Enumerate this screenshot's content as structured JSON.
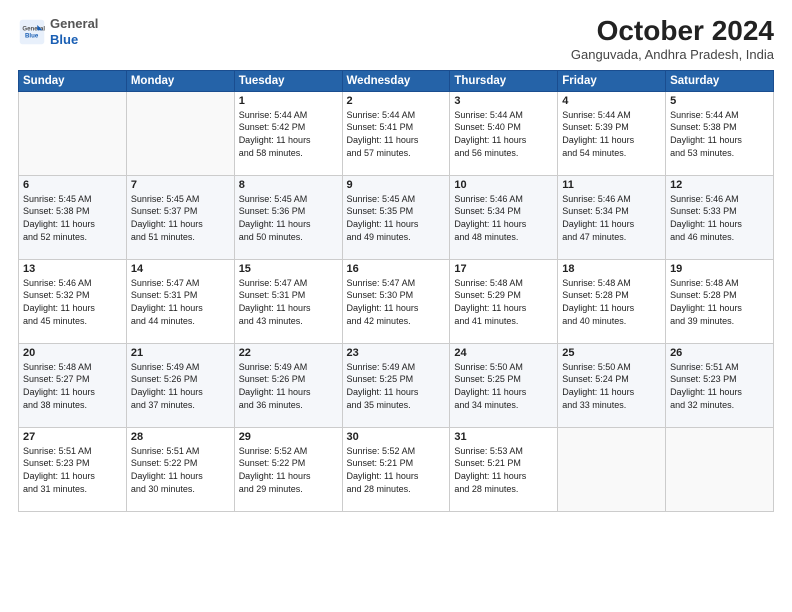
{
  "logo": {
    "general": "General",
    "blue": "Blue"
  },
  "header": {
    "month": "October 2024",
    "location": "Ganguvada, Andhra Pradesh, India"
  },
  "weekdays": [
    "Sunday",
    "Monday",
    "Tuesday",
    "Wednesday",
    "Thursday",
    "Friday",
    "Saturday"
  ],
  "weeks": [
    [
      {
        "day": "",
        "info": ""
      },
      {
        "day": "",
        "info": ""
      },
      {
        "day": "1",
        "info": "Sunrise: 5:44 AM\nSunset: 5:42 PM\nDaylight: 11 hours\nand 58 minutes."
      },
      {
        "day": "2",
        "info": "Sunrise: 5:44 AM\nSunset: 5:41 PM\nDaylight: 11 hours\nand 57 minutes."
      },
      {
        "day": "3",
        "info": "Sunrise: 5:44 AM\nSunset: 5:40 PM\nDaylight: 11 hours\nand 56 minutes."
      },
      {
        "day": "4",
        "info": "Sunrise: 5:44 AM\nSunset: 5:39 PM\nDaylight: 11 hours\nand 54 minutes."
      },
      {
        "day": "5",
        "info": "Sunrise: 5:44 AM\nSunset: 5:38 PM\nDaylight: 11 hours\nand 53 minutes."
      }
    ],
    [
      {
        "day": "6",
        "info": "Sunrise: 5:45 AM\nSunset: 5:38 PM\nDaylight: 11 hours\nand 52 minutes."
      },
      {
        "day": "7",
        "info": "Sunrise: 5:45 AM\nSunset: 5:37 PM\nDaylight: 11 hours\nand 51 minutes."
      },
      {
        "day": "8",
        "info": "Sunrise: 5:45 AM\nSunset: 5:36 PM\nDaylight: 11 hours\nand 50 minutes."
      },
      {
        "day": "9",
        "info": "Sunrise: 5:45 AM\nSunset: 5:35 PM\nDaylight: 11 hours\nand 49 minutes."
      },
      {
        "day": "10",
        "info": "Sunrise: 5:46 AM\nSunset: 5:34 PM\nDaylight: 11 hours\nand 48 minutes."
      },
      {
        "day": "11",
        "info": "Sunrise: 5:46 AM\nSunset: 5:34 PM\nDaylight: 11 hours\nand 47 minutes."
      },
      {
        "day": "12",
        "info": "Sunrise: 5:46 AM\nSunset: 5:33 PM\nDaylight: 11 hours\nand 46 minutes."
      }
    ],
    [
      {
        "day": "13",
        "info": "Sunrise: 5:46 AM\nSunset: 5:32 PM\nDaylight: 11 hours\nand 45 minutes."
      },
      {
        "day": "14",
        "info": "Sunrise: 5:47 AM\nSunset: 5:31 PM\nDaylight: 11 hours\nand 44 minutes."
      },
      {
        "day": "15",
        "info": "Sunrise: 5:47 AM\nSunset: 5:31 PM\nDaylight: 11 hours\nand 43 minutes."
      },
      {
        "day": "16",
        "info": "Sunrise: 5:47 AM\nSunset: 5:30 PM\nDaylight: 11 hours\nand 42 minutes."
      },
      {
        "day": "17",
        "info": "Sunrise: 5:48 AM\nSunset: 5:29 PM\nDaylight: 11 hours\nand 41 minutes."
      },
      {
        "day": "18",
        "info": "Sunrise: 5:48 AM\nSunset: 5:28 PM\nDaylight: 11 hours\nand 40 minutes."
      },
      {
        "day": "19",
        "info": "Sunrise: 5:48 AM\nSunset: 5:28 PM\nDaylight: 11 hours\nand 39 minutes."
      }
    ],
    [
      {
        "day": "20",
        "info": "Sunrise: 5:48 AM\nSunset: 5:27 PM\nDaylight: 11 hours\nand 38 minutes."
      },
      {
        "day": "21",
        "info": "Sunrise: 5:49 AM\nSunset: 5:26 PM\nDaylight: 11 hours\nand 37 minutes."
      },
      {
        "day": "22",
        "info": "Sunrise: 5:49 AM\nSunset: 5:26 PM\nDaylight: 11 hours\nand 36 minutes."
      },
      {
        "day": "23",
        "info": "Sunrise: 5:49 AM\nSunset: 5:25 PM\nDaylight: 11 hours\nand 35 minutes."
      },
      {
        "day": "24",
        "info": "Sunrise: 5:50 AM\nSunset: 5:25 PM\nDaylight: 11 hours\nand 34 minutes."
      },
      {
        "day": "25",
        "info": "Sunrise: 5:50 AM\nSunset: 5:24 PM\nDaylight: 11 hours\nand 33 minutes."
      },
      {
        "day": "26",
        "info": "Sunrise: 5:51 AM\nSunset: 5:23 PM\nDaylight: 11 hours\nand 32 minutes."
      }
    ],
    [
      {
        "day": "27",
        "info": "Sunrise: 5:51 AM\nSunset: 5:23 PM\nDaylight: 11 hours\nand 31 minutes."
      },
      {
        "day": "28",
        "info": "Sunrise: 5:51 AM\nSunset: 5:22 PM\nDaylight: 11 hours\nand 30 minutes."
      },
      {
        "day": "29",
        "info": "Sunrise: 5:52 AM\nSunset: 5:22 PM\nDaylight: 11 hours\nand 29 minutes."
      },
      {
        "day": "30",
        "info": "Sunrise: 5:52 AM\nSunset: 5:21 PM\nDaylight: 11 hours\nand 28 minutes."
      },
      {
        "day": "31",
        "info": "Sunrise: 5:53 AM\nSunset: 5:21 PM\nDaylight: 11 hours\nand 28 minutes."
      },
      {
        "day": "",
        "info": ""
      },
      {
        "day": "",
        "info": ""
      }
    ]
  ]
}
